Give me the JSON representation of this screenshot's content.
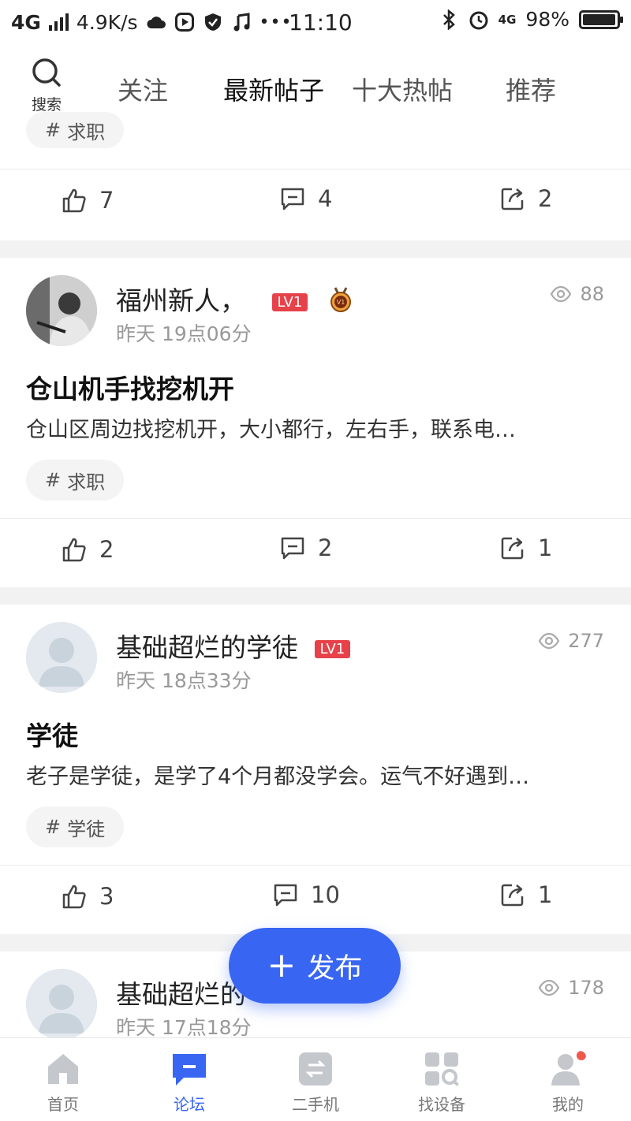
{
  "status_bar": {
    "network": "4G",
    "speed": "4.9K/s",
    "time": "11:10",
    "net_right": "4G",
    "battery": "98%",
    "battery_level": 0.98,
    "icons": [
      "cloud-icon",
      "video-icon",
      "shield-icon",
      "music-icon",
      "more-icon",
      "bluetooth-icon",
      "alarm-icon"
    ]
  },
  "top_nav": {
    "search_label": "搜索",
    "tabs": [
      "关注",
      "最新帖子",
      "十大热帖",
      "推荐"
    ],
    "active_tab": "最新帖子",
    "accent": "#3b6bf0"
  },
  "partial_post": {
    "tag": "求职",
    "likes": "7",
    "comments": "4",
    "shares": "2"
  },
  "posts": [
    {
      "user": "福州新人，",
      "level": "LV1",
      "badge": "V1",
      "time": "昨天 19点06分",
      "views": "88",
      "title": "仓山机手找挖机开",
      "body": "仓山区周边找挖机开，大小都行，左右手，联系电…",
      "tag": "求职",
      "likes": "2",
      "comments": "2",
      "shares": "1"
    },
    {
      "user": "基础超烂的学徒",
      "level": "LV1",
      "time": "昨天 18点33分",
      "views": "277",
      "title": "学徒",
      "body": "老子是学徒，是学了4个月都没学会。运气不好遇到…",
      "tag": "学徒",
      "likes": "3",
      "comments": "10",
      "shares": "1"
    },
    {
      "user": "基础超烂的",
      "time": "昨天 17点18分",
      "views": "178"
    }
  ],
  "publish_button": {
    "plus": "+",
    "label": "发布"
  },
  "bottom_nav": {
    "items": [
      "首页",
      "论坛",
      "二手机",
      "找设备",
      "我的"
    ],
    "active": "论坛",
    "accent": "#3866f2"
  }
}
